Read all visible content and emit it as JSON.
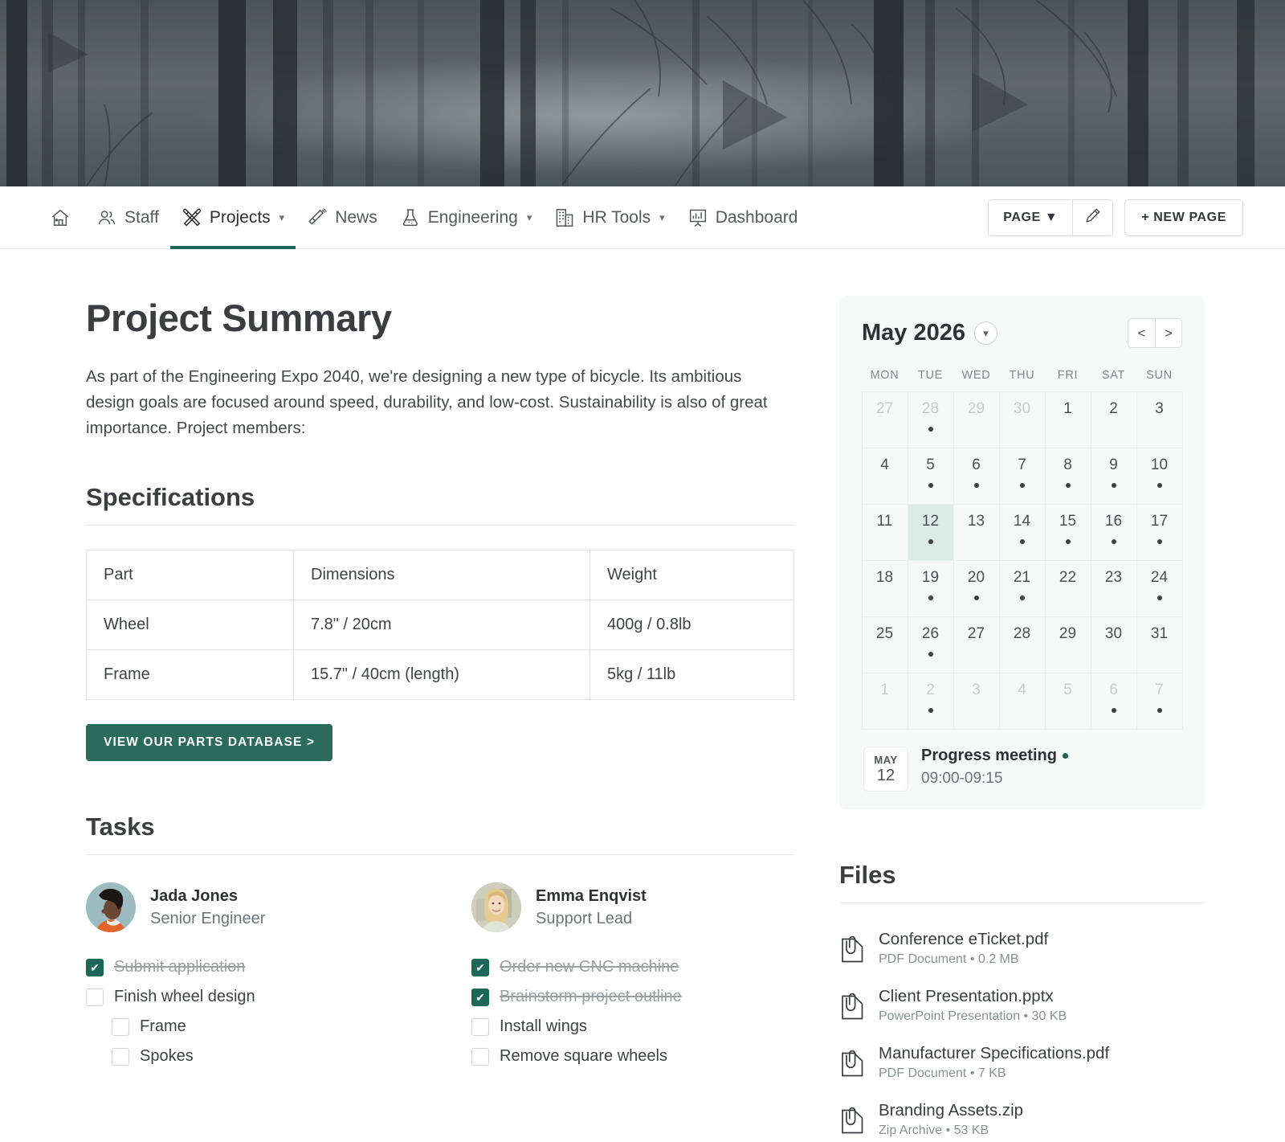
{
  "nav": {
    "items": [
      {
        "label": "",
        "icon": "home-icon",
        "caret": false,
        "active": false
      },
      {
        "label": "Staff",
        "icon": "people-icon",
        "caret": false,
        "active": false
      },
      {
        "label": "Projects",
        "icon": "tools-icon",
        "caret": true,
        "active": true
      },
      {
        "label": "News",
        "icon": "megaphone-icon",
        "caret": false,
        "active": false
      },
      {
        "label": "Engineering",
        "icon": "flask-icon",
        "caret": true,
        "active": false
      },
      {
        "label": "HR Tools",
        "icon": "building-icon",
        "caret": true,
        "active": false
      },
      {
        "label": "Dashboard",
        "icon": "easel-chart-icon",
        "caret": false,
        "active": false
      }
    ],
    "page_button": "PAGE ▼",
    "edit_icon": "pencil-icon",
    "new_page_button": "+ NEW PAGE"
  },
  "main": {
    "title": "Project Summary",
    "intro": "As part of the Engineering Expo 2040, we're designing a new type of bicycle. Its ambitious design goals are focused around speed, durability, and low-cost. Sustainability is also of great importance. Project members:",
    "specifications_heading": "Specifications",
    "spec_table": {
      "headers": [
        "Part",
        "Dimensions",
        "Weight"
      ],
      "rows": [
        [
          "Wheel",
          "7.8\" / 20cm",
          "400g / 0.8lb"
        ],
        [
          "Frame",
          "15.7\" / 40cm (length)",
          "5kg / 11lb"
        ]
      ]
    },
    "parts_button": "VIEW OUR PARTS DATABASE >",
    "tasks_heading": "Tasks",
    "people": [
      {
        "name": "Jada Jones",
        "role": "Senior Engineer",
        "avatar": "avatar-jada-jones",
        "tasks": [
          {
            "label": "Submit application",
            "checked": true,
            "sub": false
          },
          {
            "label": "Finish wheel design",
            "checked": false,
            "sub": false
          },
          {
            "label": "Frame",
            "checked": false,
            "sub": true
          },
          {
            "label": "Spokes",
            "checked": false,
            "sub": true
          }
        ]
      },
      {
        "name": "Emma Enqvist",
        "role": "Support Lead",
        "avatar": "avatar-emma-enqvist",
        "tasks": [
          {
            "label": "Order new CNC machine",
            "checked": true,
            "sub": false
          },
          {
            "label": "Brainstorm project outline",
            "checked": true,
            "sub": false
          },
          {
            "label": "Install wings",
            "checked": false,
            "sub": false
          },
          {
            "label": "Remove square wheels",
            "checked": false,
            "sub": false
          }
        ]
      }
    ]
  },
  "calendar": {
    "month_label": "May 2026",
    "expand_icon": "chevron-down-icon",
    "prev_label": "<",
    "next_label": ">",
    "weekdays": [
      "MON",
      "TUE",
      "WED",
      "THU",
      "FRI",
      "SAT",
      "SUN"
    ],
    "weeks": [
      [
        {
          "day": 27,
          "muted": true,
          "dot": false,
          "selected": false
        },
        {
          "day": 28,
          "muted": true,
          "dot": true,
          "selected": false
        },
        {
          "day": 29,
          "muted": true,
          "dot": false,
          "selected": false
        },
        {
          "day": 30,
          "muted": true,
          "dot": false,
          "selected": false
        },
        {
          "day": 1,
          "muted": false,
          "dot": false,
          "selected": false
        },
        {
          "day": 2,
          "muted": false,
          "dot": false,
          "selected": false
        },
        {
          "day": 3,
          "muted": false,
          "dot": false,
          "selected": false
        }
      ],
      [
        {
          "day": 4,
          "muted": false,
          "dot": false,
          "selected": false
        },
        {
          "day": 5,
          "muted": false,
          "dot": true,
          "selected": false
        },
        {
          "day": 6,
          "muted": false,
          "dot": true,
          "selected": false
        },
        {
          "day": 7,
          "muted": false,
          "dot": true,
          "selected": false
        },
        {
          "day": 8,
          "muted": false,
          "dot": true,
          "selected": false
        },
        {
          "day": 9,
          "muted": false,
          "dot": true,
          "selected": false
        },
        {
          "day": 10,
          "muted": false,
          "dot": true,
          "selected": false
        }
      ],
      [
        {
          "day": 11,
          "muted": false,
          "dot": false,
          "selected": false
        },
        {
          "day": 12,
          "muted": false,
          "dot": true,
          "selected": true
        },
        {
          "day": 13,
          "muted": false,
          "dot": false,
          "selected": false
        },
        {
          "day": 14,
          "muted": false,
          "dot": true,
          "selected": false
        },
        {
          "day": 15,
          "muted": false,
          "dot": true,
          "selected": false
        },
        {
          "day": 16,
          "muted": false,
          "dot": true,
          "selected": false
        },
        {
          "day": 17,
          "muted": false,
          "dot": true,
          "selected": false
        }
      ],
      [
        {
          "day": 18,
          "muted": false,
          "dot": false,
          "selected": false
        },
        {
          "day": 19,
          "muted": false,
          "dot": true,
          "selected": false
        },
        {
          "day": 20,
          "muted": false,
          "dot": true,
          "selected": false
        },
        {
          "day": 21,
          "muted": false,
          "dot": true,
          "selected": false
        },
        {
          "day": 22,
          "muted": false,
          "dot": false,
          "selected": false
        },
        {
          "day": 23,
          "muted": false,
          "dot": false,
          "selected": false
        },
        {
          "day": 24,
          "muted": false,
          "dot": true,
          "selected": false
        }
      ],
      [
        {
          "day": 25,
          "muted": false,
          "dot": false,
          "selected": false
        },
        {
          "day": 26,
          "muted": false,
          "dot": true,
          "selected": false
        },
        {
          "day": 27,
          "muted": false,
          "dot": false,
          "selected": false
        },
        {
          "day": 28,
          "muted": false,
          "dot": false,
          "selected": false
        },
        {
          "day": 29,
          "muted": false,
          "dot": false,
          "selected": false
        },
        {
          "day": 30,
          "muted": false,
          "dot": false,
          "selected": false
        },
        {
          "day": 31,
          "muted": false,
          "dot": false,
          "selected": false
        }
      ],
      [
        {
          "day": 1,
          "muted": true,
          "dot": false,
          "selected": false
        },
        {
          "day": 2,
          "muted": true,
          "dot": true,
          "selected": false
        },
        {
          "day": 3,
          "muted": true,
          "dot": false,
          "selected": false
        },
        {
          "day": 4,
          "muted": true,
          "dot": false,
          "selected": false
        },
        {
          "day": 5,
          "muted": true,
          "dot": false,
          "selected": false
        },
        {
          "day": 6,
          "muted": true,
          "dot": true,
          "selected": false
        },
        {
          "day": 7,
          "muted": true,
          "dot": true,
          "selected": false
        }
      ]
    ],
    "event": {
      "month": "MAY",
      "day": "12",
      "title": "Progress meeting",
      "time": "09:00-09:15"
    }
  },
  "files": {
    "heading": "Files",
    "items": [
      {
        "name": "Conference eTicket.pdf",
        "meta": "PDF Document • 0.2 MB",
        "icon": "file-attachment-icon"
      },
      {
        "name": "Client Presentation.pptx",
        "meta": "PowerPoint Presentation • 30 KB",
        "icon": "file-attachment-icon"
      },
      {
        "name": "Manufacturer Specifications.pdf",
        "meta": "PDF Document • 7 KB",
        "icon": "file-attachment-icon"
      },
      {
        "name": "Branding Assets.zip",
        "meta": "Zip Archive • 53 KB",
        "icon": "file-attachment-icon"
      }
    ]
  },
  "colors": {
    "accent": "#1c6758",
    "button": "#2b6b5b",
    "selected_day": "#dcebe6",
    "text": "#3b3d40",
    "muted": "#8a8f92"
  }
}
